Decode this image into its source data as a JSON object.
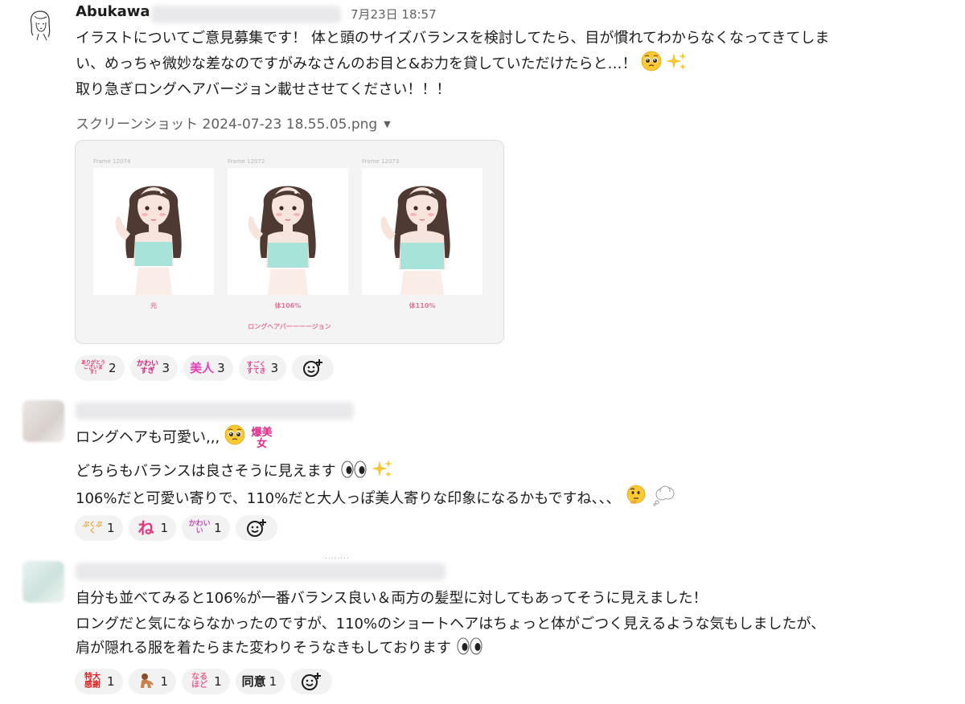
{
  "messages": [
    {
      "author": "Abukawa",
      "timestamp": "7月23日 18:57",
      "lines": [
        "イラストについてご意見募集です！ 体と頭のサイズバランスを検討してたら、目が慣れてわからなくなってきてしま",
        "い、めっちゃ微妙な差なのですがみなさんのお目と&お力を貸していただけたらと…！",
        "取り急ぎロングヘアバージョン載せさせてください！！！"
      ],
      "attachment": {
        "filename": "スクリーンショット 2024-07-23 18.55.05.png",
        "frames": [
          {
            "label": "Frame 12074",
            "caption": "元"
          },
          {
            "label": "Frame 12072",
            "caption": "体106%"
          },
          {
            "label": "Frame 12073",
            "caption": "体110%"
          }
        ],
        "subcaption": "ロングヘアバーーーージョン"
      },
      "reactions": [
        {
          "emoji": "ありがとうございます!",
          "count": "2",
          "color": "#e0386b"
        },
        {
          "emoji": "かわいすぎ",
          "count": "3",
          "color": "#d4237f"
        },
        {
          "emoji": "美人",
          "count": "3",
          "color": "#e23fb8"
        },
        {
          "emoji": "すごくすてき",
          "count": "3",
          "color": "#e03f8a"
        }
      ]
    },
    {
      "lines": [
        "ロングヘアも可愛い,,, ",
        "どちらもバランスは良さそうに見えます",
        "106%だと可愛い寄りで、110%だと大人っぽ美人寄りな印象になるかもですね、、、"
      ],
      "inline_stamp": "爆美女",
      "reactions": [
        {
          "emoji": "ぷくぷく",
          "count": "1",
          "color": "#e89a2f"
        },
        {
          "emoji": "ね",
          "count": "1",
          "color": "#e5357e"
        },
        {
          "emoji": "かわいい",
          "count": "1",
          "color": "#c84bb8"
        }
      ]
    },
    {
      "lines": [
        "自分も並べてみると106%が一番バランス良い＆両方の髪型に対してもあってそうに見えました！",
        "ロングだと気にならなかったのですが、110%のショートヘアはちょっと体がごつく見えるような気もしましたが、",
        "肩が隠れる服を着たらまた変わりそうなきもしております"
      ],
      "reactions": [
        {
          "emoji": "特大感謝",
          "count": "1",
          "color": "#e02020"
        },
        {
          "emoji": "person-bowing",
          "count": "1",
          "color": "#c8814d"
        },
        {
          "emoji": "なるほど",
          "count": "1",
          "color": "#e8658a"
        },
        {
          "emoji": "同意",
          "count": "1",
          "color": "#1d1c1d"
        }
      ]
    }
  ],
  "thread_divider": "........",
  "icons": {
    "avatar_1": "line-drawing-girl-avatar",
    "add_reaction": "add-reaction-icon",
    "file_menu": "chevron-down-icon",
    "pleading": "pleading-face-emoji",
    "sparkles": "sparkles-emoji",
    "eyes": "eyes-emoji",
    "thinking": "thinking-face-emoji",
    "thought_balloon": "thought-balloon-emoji"
  }
}
